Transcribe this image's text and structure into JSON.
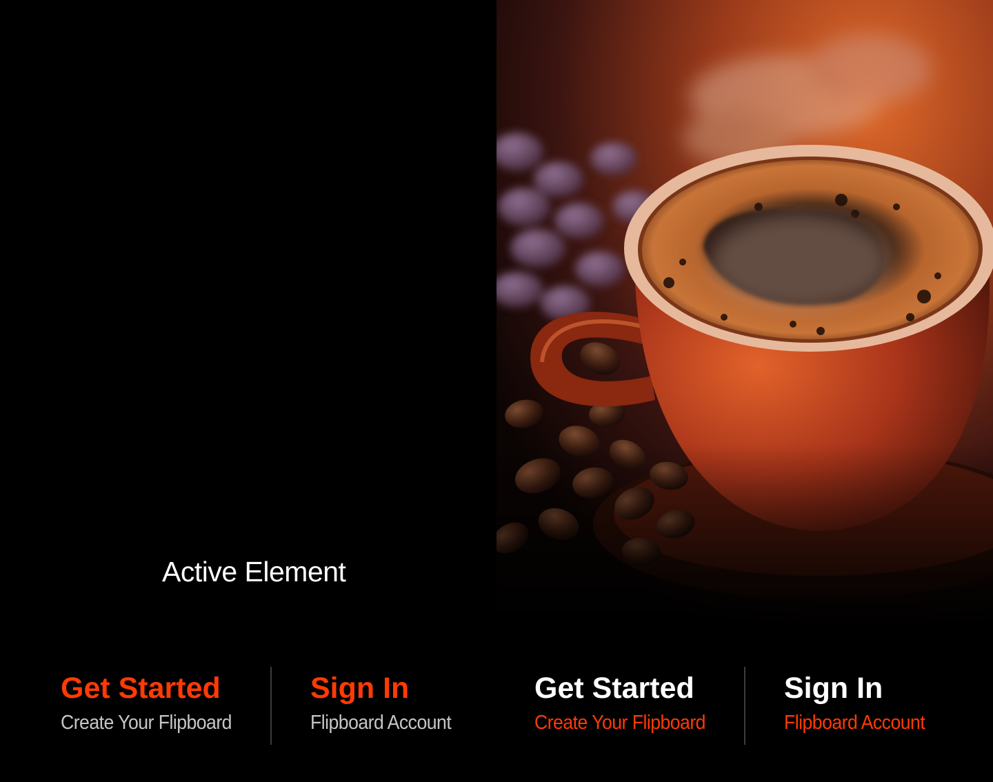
{
  "caption": "Active Element",
  "hero_image": {
    "description_icon": "coffee-cup-image"
  },
  "colors": {
    "accent": "#ff3a06",
    "sub_gray": "#c6c6c6",
    "white": "#ffffff",
    "divider": "#3c3c3c"
  },
  "actions": [
    {
      "title": "Get Started",
      "subtitle": "Create Your Flipboard",
      "state": "inactive"
    },
    {
      "title": "Sign In",
      "subtitle": "Flipboard Account",
      "state": "inactive"
    },
    {
      "title": "Get Started",
      "subtitle": "Create Your Flipboard",
      "state": "active"
    },
    {
      "title": "Sign In",
      "subtitle": "Flipboard Account",
      "state": "active"
    }
  ]
}
